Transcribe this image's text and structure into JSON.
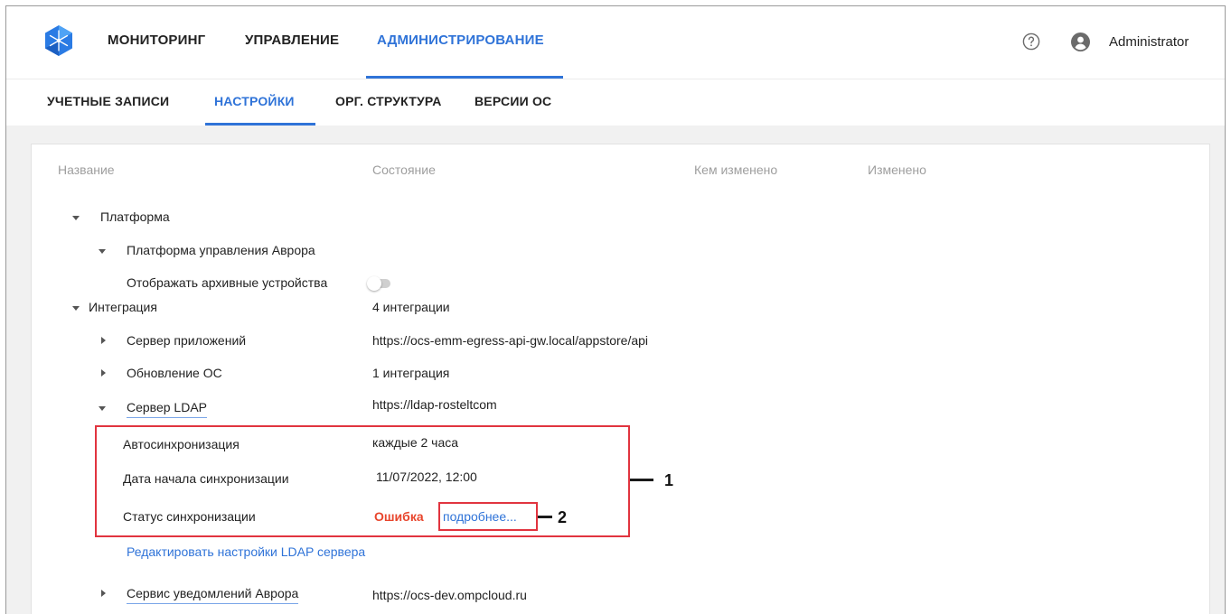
{
  "header": {
    "nav": [
      "МОНИТОРИНГ",
      "УПРАВЛЕНИЕ",
      "АДМИНИСТРИРОВАНИЕ"
    ],
    "user": "Administrator",
    "icons": [
      "logo-icon",
      "help-icon",
      "user-icon"
    ]
  },
  "subnav": [
    "УЧЕТНЫЕ ЗАПИСИ",
    "НАСТРОЙКИ",
    "ОРГ. СТРУКТУРА",
    "ВЕРСИИ ОС"
  ],
  "table": {
    "columns": [
      "Название",
      "Состояние",
      "Кем изменено",
      "Изменено"
    ]
  },
  "rows": {
    "platform": "Платформа",
    "platform_aurora": "Платформа управления Аврора",
    "show_archived": "Отображать архивные устройства",
    "integration": "Интеграция",
    "integration_value": "4 интеграции",
    "app_server": "Сервер приложений",
    "app_server_value": "https://ocs-emm-egress-api-gw.local/appstore/api",
    "os_update": "Обновление ОС",
    "os_update_value": "1 интеграция",
    "ldap": "Сервер LDAP",
    "ldap_value": "https://ldap-rosteltcom",
    "autosync": "Автосинхронизация",
    "autosync_value": "каждые 2 часа",
    "sync_start": "Дата начала синхронизации",
    "sync_start_value": "11/07/2022, 12:00",
    "sync_status": "Статус синхронизации",
    "sync_status_value": "Ошибка",
    "details_link": "подробнее...",
    "edit_ldap": "Редактировать настройки LDAP сервера",
    "notify": "Сервис уведомлений Аврора",
    "notify_value": "https://ocs-dev.ompcloud.ru"
  },
  "callouts": [
    "1",
    "2"
  ],
  "colors": {
    "accent": "#2f73d8",
    "error": "#e8452c",
    "callout": "#e1343f",
    "background": "#f1f1f1"
  }
}
